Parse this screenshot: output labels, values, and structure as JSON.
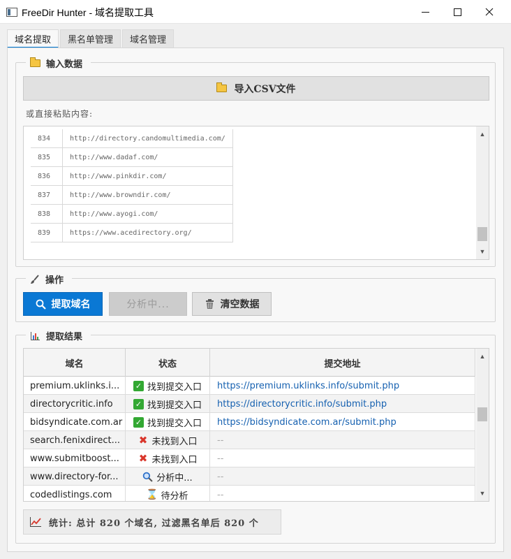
{
  "window": {
    "title": "FreeDir Hunter - 域名提取工具"
  },
  "tabs": [
    {
      "label": "域名提取",
      "active": true
    },
    {
      "label": "黑名单管理",
      "active": false
    },
    {
      "label": "域名管理",
      "active": false
    }
  ],
  "input_group": {
    "title": "输入数据",
    "import_button": "导入CSV文件",
    "paste_label": "或直接粘贴内容:",
    "rows": [
      {
        "line": "834",
        "url": "http://directory.candomultimedia.com/"
      },
      {
        "line": "835",
        "url": "http://www.dadaf.com/"
      },
      {
        "line": "836",
        "url": "http://www.pinkdir.com/"
      },
      {
        "line": "837",
        "url": "http://www.browndir.com/"
      },
      {
        "line": "838",
        "url": "http://www.ayogi.com/"
      },
      {
        "line": "839",
        "url": "https://www.acedirectory.org/"
      }
    ]
  },
  "ops_group": {
    "title": "操作",
    "extract_button": "提取域名",
    "analyzing_button": "分析中...",
    "clear_button": "清空数据"
  },
  "results_group": {
    "title": "提取结果",
    "columns": [
      "域名",
      "状态",
      "提交地址"
    ],
    "rows": [
      {
        "domain": "premium.uklinks.i...",
        "status_icon": "check-icon",
        "status": "找到提交入口",
        "url": "https://premium.uklinks.info/submit.php"
      },
      {
        "domain": "directorycritic.info",
        "status_icon": "check-icon",
        "status": "找到提交入口",
        "url": "https://directorycritic.info/submit.php"
      },
      {
        "domain": "bidsyndicate.com.ar",
        "status_icon": "check-icon",
        "status": "找到提交入口",
        "url": "https://bidsyndicate.com.ar/submit.php"
      },
      {
        "domain": "search.fenixdirect...",
        "status_icon": "cross-icon",
        "status": "未找到入口",
        "url": "--"
      },
      {
        "domain": "www.submitboost...",
        "status_icon": "cross-icon",
        "status": "未找到入口",
        "url": "--"
      },
      {
        "domain": "www.directory-for...",
        "status_icon": "search-icon",
        "status": "分析中...",
        "url": "--"
      },
      {
        "domain": "codedlistings.com",
        "status_icon": "hourglass-icon",
        "status": "待分析",
        "url": "--"
      }
    ],
    "stats": "统计: 总计 820 个域名, 过滤黑名单后 820 个"
  },
  "colors": {
    "accent": "#0a78d4",
    "link": "#1560b0",
    "success": "#33a833",
    "error": "#d9362b"
  }
}
